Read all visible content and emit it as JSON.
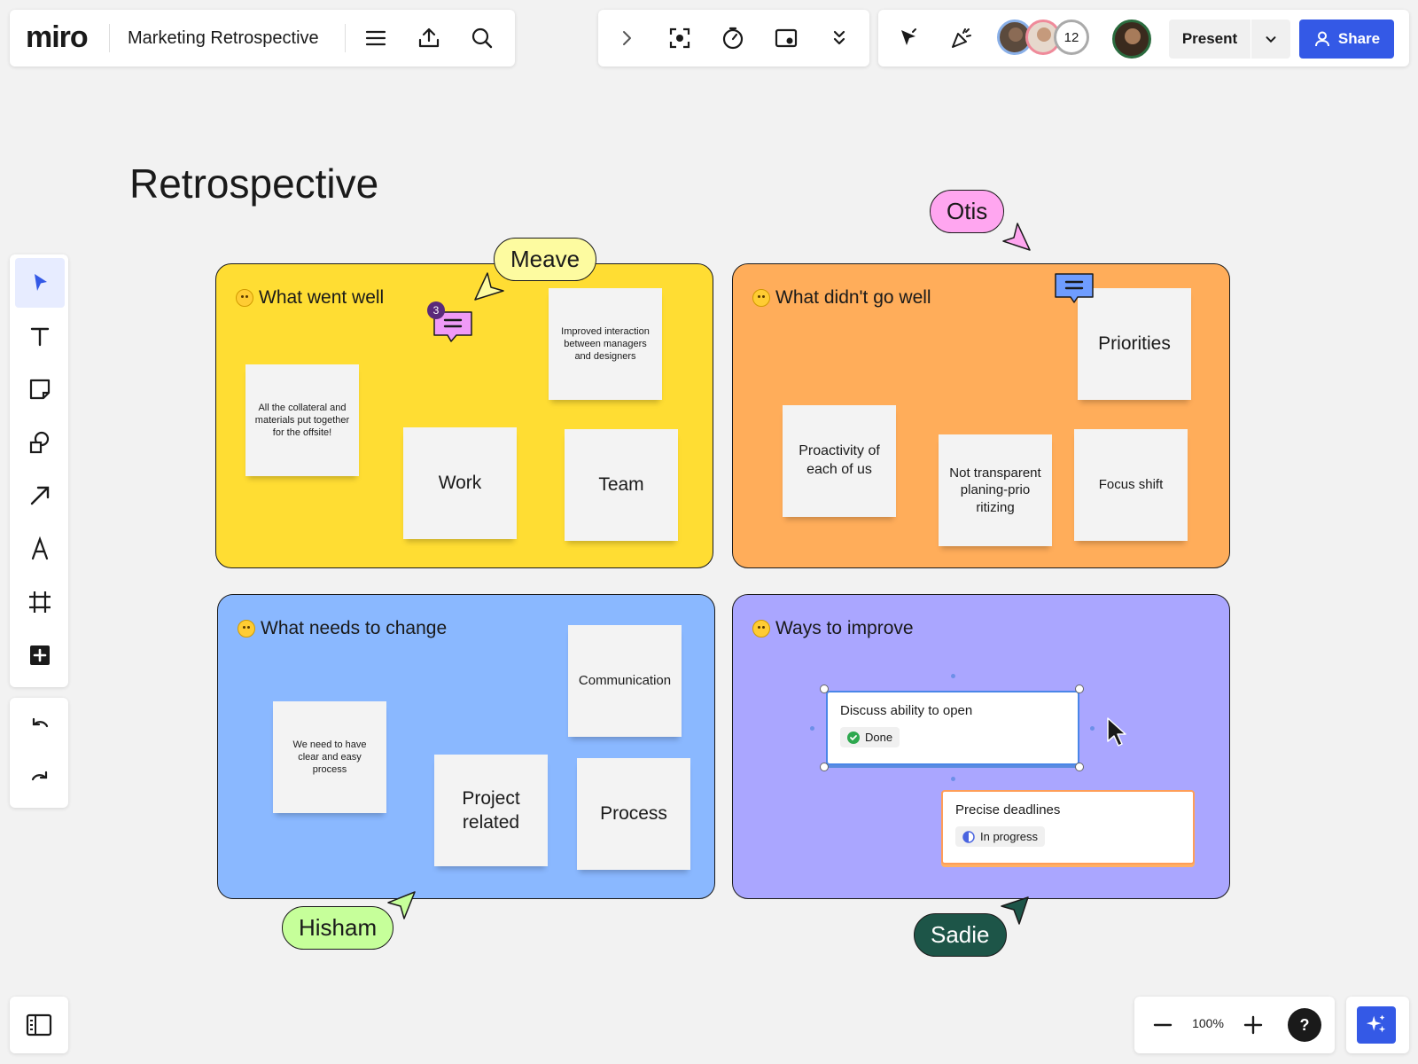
{
  "header": {
    "logo": "miro",
    "board_title": "Marketing Retrospective",
    "menu_icon": "hamburger-menu-icon",
    "upload_icon": "upload-icon",
    "search_icon": "search-icon"
  },
  "center_toolbar": {
    "icons": [
      "chevron-right-icon",
      "focus-frame-icon",
      "timer-icon",
      "card-sync-icon",
      "chevrons-down-icon"
    ]
  },
  "right_toolbar": {
    "icons": [
      "cursor-follow-icon",
      "celebrate-icon"
    ],
    "collaborator_count": "12",
    "present_label": "Present",
    "share_label": "Share"
  },
  "board": {
    "title": "Retrospective",
    "frames": [
      {
        "title": "What went well",
        "color": "#ffdd33"
      },
      {
        "title": "What didn't go well",
        "color": "#ffad5a"
      },
      {
        "title": "What needs to change",
        "color": "#8ab8ff"
      },
      {
        "title": "Ways to improve",
        "color": "#aaa6ff"
      }
    ],
    "stickies": {
      "went_well": [
        "Improved interaction between managers and designers",
        "All the collateral and materials put together for the offsite!",
        "Work",
        "Team"
      ],
      "didnt_go_well": [
        "Priorities",
        "Proactivity of each of us",
        "Not transparent planing-prio ritizing",
        "Focus shift"
      ],
      "needs_change": [
        "Communication",
        "We need to have clear and easy process",
        "Project related",
        "Process"
      ]
    },
    "cards": [
      {
        "title": "Discuss ability to open",
        "status": "Done"
      },
      {
        "title": "Precise deadlines",
        "status": "In progress"
      }
    ],
    "comment_count": "3",
    "cursors": [
      {
        "name": "Meave",
        "color": "#fdfba0"
      },
      {
        "name": "Otis",
        "color": "#ffa6f0"
      },
      {
        "name": "Hisham",
        "color": "#c6ff9a"
      },
      {
        "name": "Sadie",
        "color": "#1d5548"
      }
    ]
  },
  "left_toolbar": {
    "tools": [
      "select-icon",
      "text-icon",
      "sticky-note-icon",
      "shapes-icon",
      "arrow-icon",
      "pen-icon",
      "frame-icon",
      "add-icon"
    ],
    "undo_icon": "undo-icon",
    "redo_icon": "redo-icon"
  },
  "bottom": {
    "zoom_level": "100%",
    "help_label": "?",
    "panel_icon": "board-panel-icon",
    "ai_icon": "ai-sparkle-icon"
  }
}
